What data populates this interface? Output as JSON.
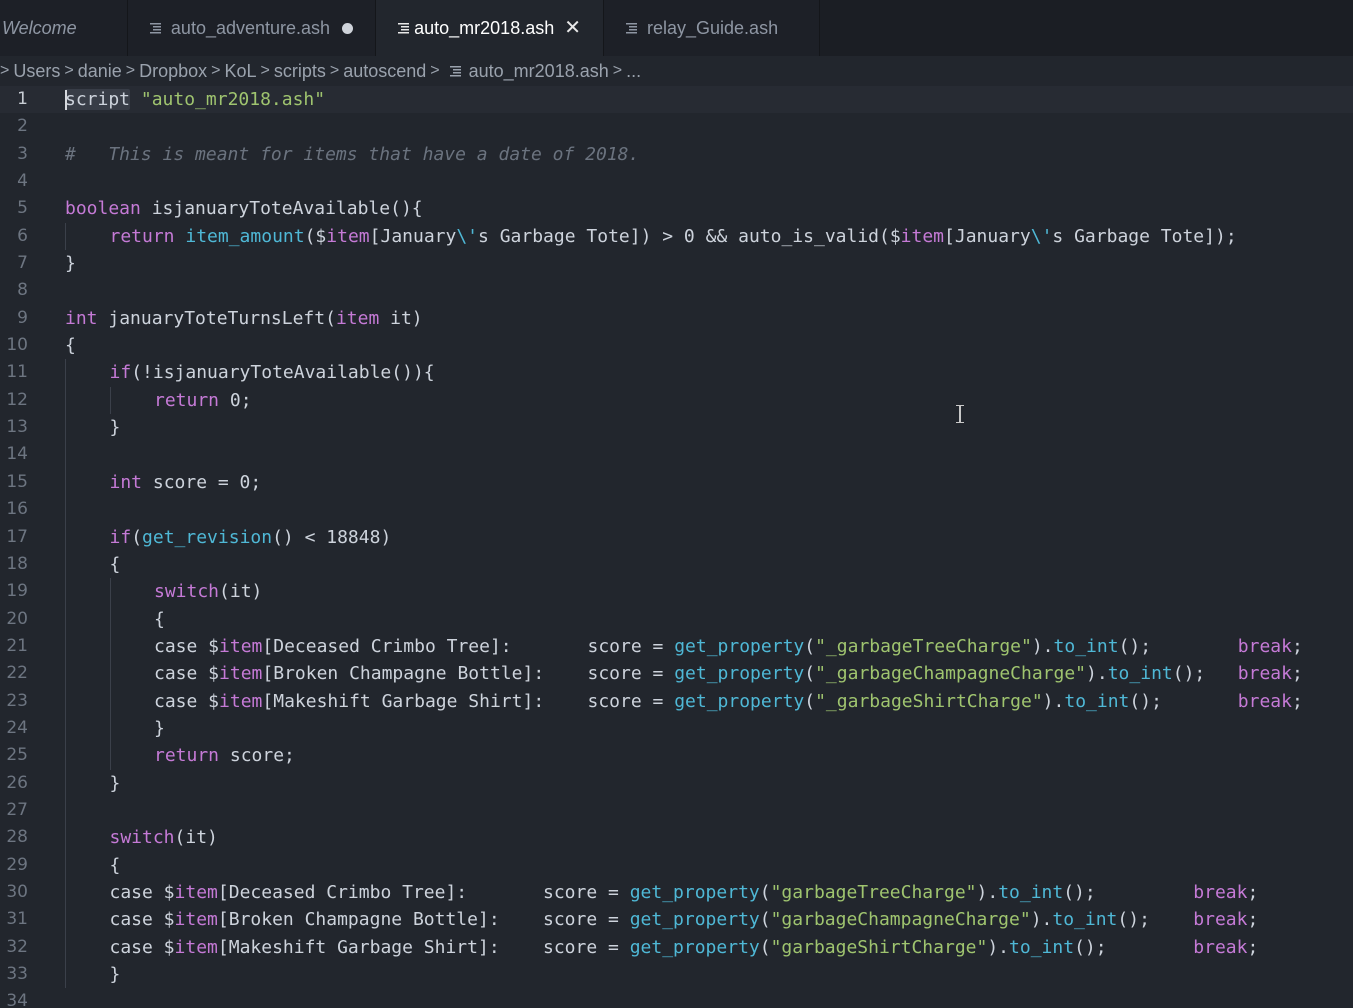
{
  "tabs": [
    {
      "label": "Welcome",
      "active": false,
      "dirty": false
    },
    {
      "label": "auto_adventure.ash",
      "active": false,
      "dirty": true
    },
    {
      "label": "auto_mr2018.ash",
      "active": true,
      "dirty": false
    },
    {
      "label": "relay_Guide.ash",
      "active": false,
      "dirty": false
    }
  ],
  "breadcrumb": [
    "Users",
    "danie",
    "Dropbox",
    "KoL",
    "scripts",
    "autoscend",
    "auto_mr2018.ash",
    "..."
  ],
  "editor": {
    "current_line": 1,
    "lines": [
      {
        "n": "1",
        "indent": 0,
        "tokens": [
          [
            "pl",
            "script"
          ],
          [
            "pl",
            " "
          ],
          [
            "str",
            "\"auto_mr2018.ash\""
          ]
        ]
      },
      {
        "n": "2",
        "indent": 0,
        "tokens": []
      },
      {
        "n": "3",
        "indent": 0,
        "tokens": [
          [
            "cm",
            "#   This is meant for items that have a date of 2018."
          ]
        ]
      },
      {
        "n": "4",
        "indent": 0,
        "tokens": []
      },
      {
        "n": "5",
        "indent": 0,
        "tokens": [
          [
            "kw",
            "boolean"
          ],
          [
            "pl",
            " isjanuaryToteAvailable(){"
          ]
        ]
      },
      {
        "n": "6",
        "indent": 1,
        "tokens": [
          [
            "kw",
            "return"
          ],
          [
            "pl",
            " "
          ],
          [
            "fn",
            "item_amount"
          ],
          [
            "pl",
            "($"
          ],
          [
            "kw",
            "item"
          ],
          [
            "pl",
            "[January"
          ],
          [
            "esc",
            "\\'"
          ],
          [
            "pl",
            "s Garbage Tote]) > 0 && auto_is_valid($"
          ],
          [
            "kw",
            "item"
          ],
          [
            "pl",
            "[January"
          ],
          [
            "esc",
            "\\'"
          ],
          [
            "pl",
            "s Garbage Tote]);"
          ]
        ]
      },
      {
        "n": "7",
        "indent": 0,
        "tokens": [
          [
            "pl",
            "}"
          ]
        ]
      },
      {
        "n": "8",
        "indent": 0,
        "tokens": []
      },
      {
        "n": "9",
        "indent": 0,
        "tokens": [
          [
            "kw",
            "int"
          ],
          [
            "pl",
            " januaryToteTurnsLeft("
          ],
          [
            "kw",
            "item"
          ],
          [
            "pl",
            " it)"
          ]
        ]
      },
      {
        "n": "10",
        "indent": 0,
        "tokens": [
          [
            "pl",
            "{"
          ]
        ]
      },
      {
        "n": "11",
        "indent": 1,
        "tokens": [
          [
            "kw",
            "if"
          ],
          [
            "pl",
            "(!isjanuaryToteAvailable()){"
          ]
        ]
      },
      {
        "n": "12",
        "indent": 2,
        "tokens": [
          [
            "kw",
            "return"
          ],
          [
            "pl",
            " 0;"
          ]
        ]
      },
      {
        "n": "13",
        "indent": 1,
        "tokens": [
          [
            "pl",
            "}"
          ]
        ]
      },
      {
        "n": "14",
        "indent": 1,
        "tokens": []
      },
      {
        "n": "15",
        "indent": 1,
        "tokens": [
          [
            "kw",
            "int"
          ],
          [
            "pl",
            " score = 0;"
          ]
        ]
      },
      {
        "n": "16",
        "indent": 1,
        "tokens": []
      },
      {
        "n": "17",
        "indent": 1,
        "tokens": [
          [
            "kw",
            "if"
          ],
          [
            "pl",
            "("
          ],
          [
            "fn",
            "get_revision"
          ],
          [
            "pl",
            "() < 18848)"
          ]
        ]
      },
      {
        "n": "18",
        "indent": 1,
        "tokens": [
          [
            "pl",
            "{"
          ]
        ]
      },
      {
        "n": "19",
        "indent": 2,
        "tokens": [
          [
            "kw",
            "switch"
          ],
          [
            "pl",
            "(it)"
          ]
        ]
      },
      {
        "n": "20",
        "indent": 2,
        "tokens": [
          [
            "pl",
            "{"
          ]
        ]
      },
      {
        "n": "21",
        "indent": 2,
        "tokens": [
          [
            "pl",
            "case $"
          ],
          [
            "kw",
            "item"
          ],
          [
            "pl",
            "[Deceased Crimbo Tree]:       score = "
          ],
          [
            "fn",
            "get_property"
          ],
          [
            "pl",
            "("
          ],
          [
            "str",
            "\"_garbageTreeCharge\""
          ],
          [
            "pl",
            ")."
          ],
          [
            "fn",
            "to_int"
          ],
          [
            "pl",
            "();        "
          ],
          [
            "kw",
            "break"
          ],
          [
            "pl",
            ";"
          ]
        ]
      },
      {
        "n": "22",
        "indent": 2,
        "tokens": [
          [
            "pl",
            "case $"
          ],
          [
            "kw",
            "item"
          ],
          [
            "pl",
            "[Broken Champagne Bottle]:    score = "
          ],
          [
            "fn",
            "get_property"
          ],
          [
            "pl",
            "("
          ],
          [
            "str",
            "\"_garbageChampagneCharge\""
          ],
          [
            "pl",
            ")."
          ],
          [
            "fn",
            "to_int"
          ],
          [
            "pl",
            "();   "
          ],
          [
            "kw",
            "break"
          ],
          [
            "pl",
            ";"
          ]
        ]
      },
      {
        "n": "23",
        "indent": 2,
        "tokens": [
          [
            "pl",
            "case $"
          ],
          [
            "kw",
            "item"
          ],
          [
            "pl",
            "[Makeshift Garbage Shirt]:    score = "
          ],
          [
            "fn",
            "get_property"
          ],
          [
            "pl",
            "("
          ],
          [
            "str",
            "\"_garbageShirtCharge\""
          ],
          [
            "pl",
            ")."
          ],
          [
            "fn",
            "to_int"
          ],
          [
            "pl",
            "();       "
          ],
          [
            "kw",
            "break"
          ],
          [
            "pl",
            ";"
          ]
        ]
      },
      {
        "n": "24",
        "indent": 2,
        "tokens": [
          [
            "pl",
            "}"
          ]
        ]
      },
      {
        "n": "25",
        "indent": 2,
        "tokens": [
          [
            "kw",
            "return"
          ],
          [
            "pl",
            " score;"
          ]
        ]
      },
      {
        "n": "26",
        "indent": 1,
        "tokens": [
          [
            "pl",
            "}"
          ]
        ]
      },
      {
        "n": "27",
        "indent": 1,
        "tokens": []
      },
      {
        "n": "28",
        "indent": 1,
        "tokens": [
          [
            "kw",
            "switch"
          ],
          [
            "pl",
            "(it)"
          ]
        ]
      },
      {
        "n": "29",
        "indent": 1,
        "tokens": [
          [
            "pl",
            "{"
          ]
        ]
      },
      {
        "n": "30",
        "indent": 1,
        "tokens": [
          [
            "pl",
            "case $"
          ],
          [
            "kw",
            "item"
          ],
          [
            "pl",
            "[Deceased Crimbo Tree]:       score = "
          ],
          [
            "fn",
            "get_property"
          ],
          [
            "pl",
            "("
          ],
          [
            "str",
            "\"garbageTreeCharge\""
          ],
          [
            "pl",
            ")."
          ],
          [
            "fn",
            "to_int"
          ],
          [
            "pl",
            "();         "
          ],
          [
            "kw",
            "break"
          ],
          [
            "pl",
            ";"
          ]
        ]
      },
      {
        "n": "31",
        "indent": 1,
        "tokens": [
          [
            "pl",
            "case $"
          ],
          [
            "kw",
            "item"
          ],
          [
            "pl",
            "[Broken Champagne Bottle]:    score = "
          ],
          [
            "fn",
            "get_property"
          ],
          [
            "pl",
            "("
          ],
          [
            "str",
            "\"garbageChampagneCharge\""
          ],
          [
            "pl",
            ")."
          ],
          [
            "fn",
            "to_int"
          ],
          [
            "pl",
            "();    "
          ],
          [
            "kw",
            "break"
          ],
          [
            "pl",
            ";"
          ]
        ]
      },
      {
        "n": "32",
        "indent": 1,
        "tokens": [
          [
            "pl",
            "case $"
          ],
          [
            "kw",
            "item"
          ],
          [
            "pl",
            "[Makeshift Garbage Shirt]:    score = "
          ],
          [
            "fn",
            "get_property"
          ],
          [
            "pl",
            "("
          ],
          [
            "str",
            "\"garbageShirtCharge\""
          ],
          [
            "pl",
            ")."
          ],
          [
            "fn",
            "to_int"
          ],
          [
            "pl",
            "();        "
          ],
          [
            "kw",
            "break"
          ],
          [
            "pl",
            ";"
          ]
        ]
      },
      {
        "n": "33",
        "indent": 1,
        "tokens": [
          [
            "pl",
            "}"
          ]
        ]
      },
      {
        "n": "34",
        "indent": 0,
        "tokens": []
      }
    ]
  },
  "colors": {
    "background": "#22262d",
    "keyword": "#c57ad6",
    "function": "#4fb8d6",
    "string": "#9fc46f",
    "comment": "#6b737f"
  }
}
